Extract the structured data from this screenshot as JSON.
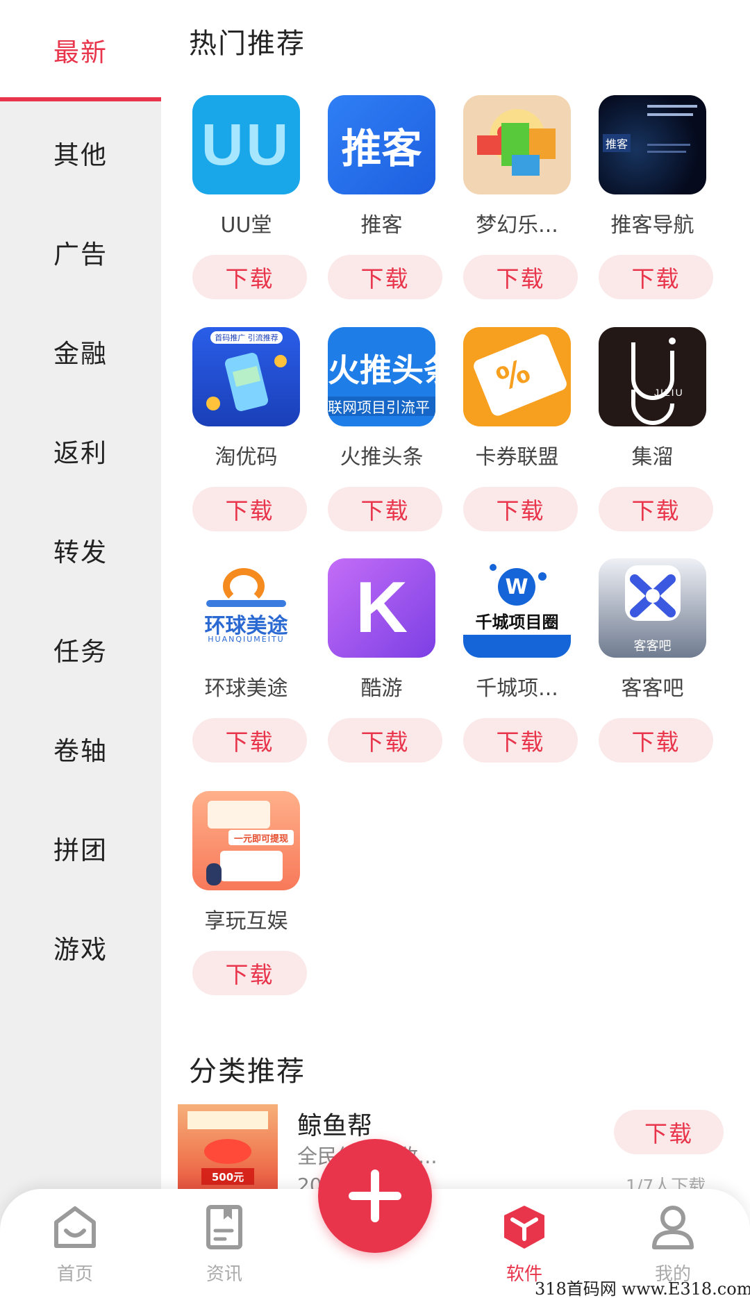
{
  "sidebar": {
    "items": [
      {
        "label": "最新",
        "active": true
      },
      {
        "label": "其他"
      },
      {
        "label": "广告"
      },
      {
        "label": "金融"
      },
      {
        "label": "返利"
      },
      {
        "label": "转发"
      },
      {
        "label": "任务"
      },
      {
        "label": "卷轴"
      },
      {
        "label": "拼团"
      },
      {
        "label": "游戏"
      }
    ]
  },
  "hot": {
    "title": "热门推荐",
    "apps": [
      {
        "name": "UU堂",
        "button": "下载",
        "icon_text": "UU"
      },
      {
        "name": "推客",
        "button": "下载",
        "icon_text": "推客"
      },
      {
        "name": "梦幻乐...",
        "button": "下载"
      },
      {
        "name": "推客导航",
        "button": "下载",
        "icon_text": "推客"
      },
      {
        "name": "淘优码",
        "button": "下载",
        "icon_text": "首码推广 引流推荐"
      },
      {
        "name": "火推头条",
        "button": "下载",
        "icon_text": "火推头条",
        "icon_sub": "联网项目引流平"
      },
      {
        "name": "卡券联盟",
        "button": "下载",
        "icon_text": "%"
      },
      {
        "name": "集溜",
        "button": "下载",
        "icon_text": "JILIU"
      },
      {
        "name": "环球美途",
        "button": "下载",
        "icon_text": "环球美途",
        "icon_sub": "HUANQIUMEITU"
      },
      {
        "name": "酷游",
        "button": "下载",
        "icon_text": "K"
      },
      {
        "name": "千城项...",
        "button": "下载",
        "icon_text": "千城项目圈",
        "icon_sub": "W"
      },
      {
        "name": "客客吧",
        "button": "下载",
        "icon_text": "客客吧"
      },
      {
        "name": "享玩互娱",
        "button": "下载",
        "icon_text": "一元即可提现"
      }
    ]
  },
  "category": {
    "title": "分类推荐",
    "item": {
      "title": "鲸鱼帮",
      "desc": "全民红推广收...",
      "meta": "20",
      "button": "下载",
      "count": "1/7人下载",
      "thumb_text": "500元"
    }
  },
  "nav": {
    "items": [
      {
        "label": "首页",
        "icon": "home-icon"
      },
      {
        "label": "资讯",
        "icon": "news-icon"
      },
      {
        "label": "软件",
        "icon": "software-cube-icon",
        "active": true
      },
      {
        "label": "我的",
        "icon": "profile-icon"
      }
    ]
  },
  "fab": {
    "icon": "plus-icon"
  },
  "watermark": "318首码网 www.E318.com",
  "colors": {
    "accent": "#e8354b",
    "button_bg": "#fbe9ea",
    "sidebar_bg": "#efefef"
  }
}
